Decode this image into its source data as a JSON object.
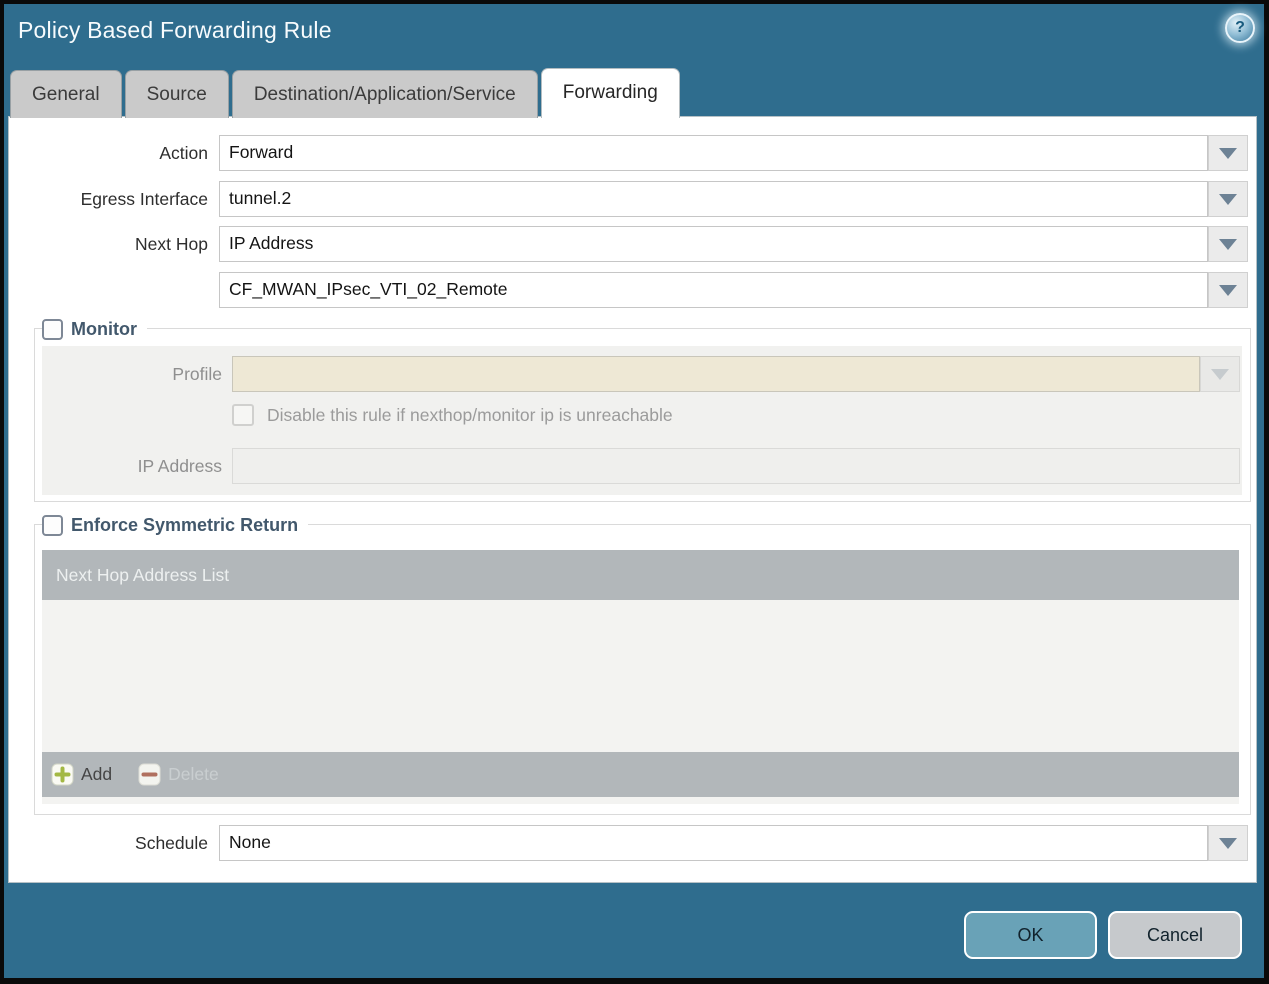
{
  "window": {
    "title": "Policy Based Forwarding Rule"
  },
  "icons": {
    "help": "?",
    "add": "plus-icon",
    "delete": "minus-icon",
    "dropdown": "triangle-down"
  },
  "colors": {
    "titlebar_bg": "#2f6d8e",
    "inactive_tab_bg": "#cacaca",
    "active_tab_bg": "#ffffff",
    "disabled_profile_field_bg": "#eee8d5",
    "table_header_bg": "#b2b7ba",
    "legend_text": "#42586c",
    "ok_button_bg": "#69a2b7",
    "cancel_button_bg": "#c6c9cc"
  },
  "tabs": [
    {
      "label": "General",
      "active": false
    },
    {
      "label": "Source",
      "active": false
    },
    {
      "label": "Destination/Application/Service",
      "active": false
    },
    {
      "label": "Forwarding",
      "active": true
    }
  ],
  "form": {
    "action": {
      "label": "Action",
      "value": "Forward"
    },
    "egress_interface": {
      "label": "Egress Interface",
      "value": "tunnel.2"
    },
    "next_hop": {
      "label": "Next Hop",
      "value": "IP Address"
    },
    "next_hop_address": {
      "value": "CF_MWAN_IPsec_VTI_02_Remote"
    },
    "schedule": {
      "label": "Schedule",
      "value": "None"
    }
  },
  "monitor": {
    "legend": "Monitor",
    "checked": false,
    "profile": {
      "label": "Profile",
      "value": ""
    },
    "disable_rule": {
      "label": "Disable this rule if nexthop/monitor ip is unreachable",
      "checked": false
    },
    "ip_address": {
      "label": "IP Address",
      "value": ""
    }
  },
  "enforce_symmetric_return": {
    "legend": "Enforce Symmetric Return",
    "checked": false,
    "next_hop_table": {
      "header": "Next Hop Address List",
      "rows": [],
      "add_label": "Add",
      "delete_label": "Delete"
    }
  },
  "footer": {
    "ok_label": "OK",
    "cancel_label": "Cancel"
  }
}
